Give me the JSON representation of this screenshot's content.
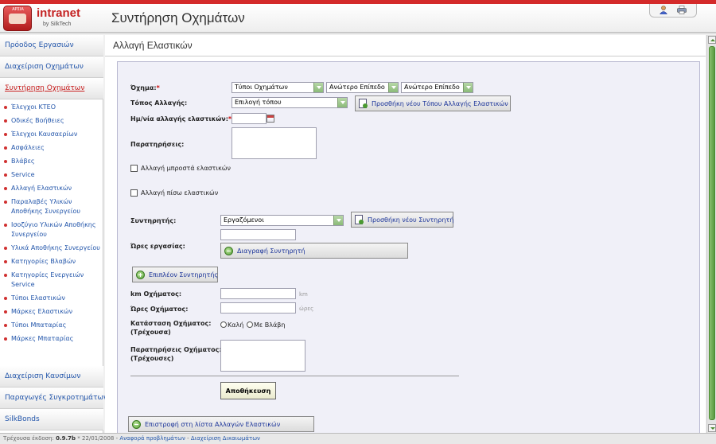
{
  "header": {
    "logo_top": "ΑΡΣΙΑ",
    "logo_word": "intranet",
    "logo_sub": "by SilkTech",
    "title": "Συντήρηση Οχημάτων"
  },
  "sidebar": {
    "top_sections": [
      {
        "label": "Πρόοδος Εργασιών"
      },
      {
        "label": "Διαχείριση Οχημάτων"
      },
      {
        "label": "Συντήρηση Οχημάτων"
      }
    ],
    "items": [
      {
        "label": "Έλεγχοι ΚΤΕΟ"
      },
      {
        "label": "Οδικές Βοήθειες"
      },
      {
        "label": "Έλεγχοι Καυσαερίων"
      },
      {
        "label": "Ασφάλειες"
      },
      {
        "label": "Βλάβες"
      },
      {
        "label": "Service"
      },
      {
        "label": "Αλλαγή Ελαστικών"
      },
      {
        "label": "Παραλαβές Υλικών Αποθήκης Συνεργείου"
      },
      {
        "label": "Ισοζύγιο Υλικών Αποθήκης Συνεργείου"
      },
      {
        "label": "Υλικά Αποθήκης Συνεργείου"
      },
      {
        "label": "Κατηγορίες Βλαβών"
      },
      {
        "label": "Κατηγορίες Ενεργειών Service"
      },
      {
        "label": "Τύποι Ελαστικών"
      },
      {
        "label": "Μάρκες Ελαστικών"
      },
      {
        "label": "Τύποι Μπαταρίας"
      },
      {
        "label": "Μάρκες Μπαταρίας"
      }
    ],
    "bottom_sections": [
      {
        "label": "Διαχείριση Καυσίμων"
      },
      {
        "label": "Παραγωγές Συγκροτημάτων"
      },
      {
        "label": "SilkBonds"
      }
    ]
  },
  "content": {
    "title": "Αλλαγή Ελαστικών"
  },
  "form": {
    "vehicle_label": "Όχημα:",
    "req_mark": "*",
    "vehicle_select1": "Τύποι Οχημάτων",
    "vehicle_select2": "Ανώτερο Επίπεδο",
    "vehicle_select3": "Ανώτερο Επίπεδο",
    "place_label": "Τόπος Αλλαγής:",
    "place_select": "Επιλογή τόπου",
    "add_place_button": "Προσθήκη νέου Τόπου Αλλαγής Ελαστικών",
    "date_label": "Ημ/νία αλλαγής ελαστικών:",
    "date_value": "",
    "notes_label": "Παρατηρήσεις:",
    "notes_value": "",
    "front_tires_label": "Αλλαγή μπροστά ελαστικών",
    "rear_tires_label": "Αλλαγή πίσω ελαστικών",
    "maintainer_label": "Συντηρητής:",
    "maintainer_select": "Εργαζόμενοι",
    "add_maintainer_button": "Προσθήκη νέου Συντηρητή",
    "work_hours_label": "Ώρες εργασίας:",
    "work_hours_value": "",
    "delete_maintainer_button": "Διαγραφή Συντηρητή",
    "more_maintainers_button": "Επιπλέον Συντηρητής",
    "km_label": "km Οχήματος:",
    "km_value": "",
    "km_unit": "km",
    "vehicle_hours_label": "Ώρες Οχήματος:",
    "vehicle_hours_value": "",
    "vehicle_hours_unit": "ώρες",
    "status_label_1": "Κατάσταση Οχήματος:",
    "status_label_2": "(Τρέχουσα)",
    "status_ok": "Καλή",
    "status_fault": "Με Βλάβη",
    "vehicle_notes_label_1": "Παρατηρήσεις Οχήματος:",
    "vehicle_notes_label_2": "(Τρέχουσες)",
    "vehicle_notes_value": "",
    "save_button": "Αποθήκευση",
    "back_button": "Επιστροφή στη λίστα Αλλαγών Ελαστικών"
  },
  "footer": {
    "version_label": "Τρέχουσα έκδοση:",
    "version": "0.9.7b",
    "date": "* 22/01/2008 -",
    "link1": "Αναφορά προβλημάτων",
    "sep": "-",
    "link2": "Διαχείριση Δικαιωμάτων"
  },
  "colors": {
    "accent_red": "#d42a2a",
    "link_blue": "#2255aa",
    "scroll_green": "#5a9a40"
  }
}
